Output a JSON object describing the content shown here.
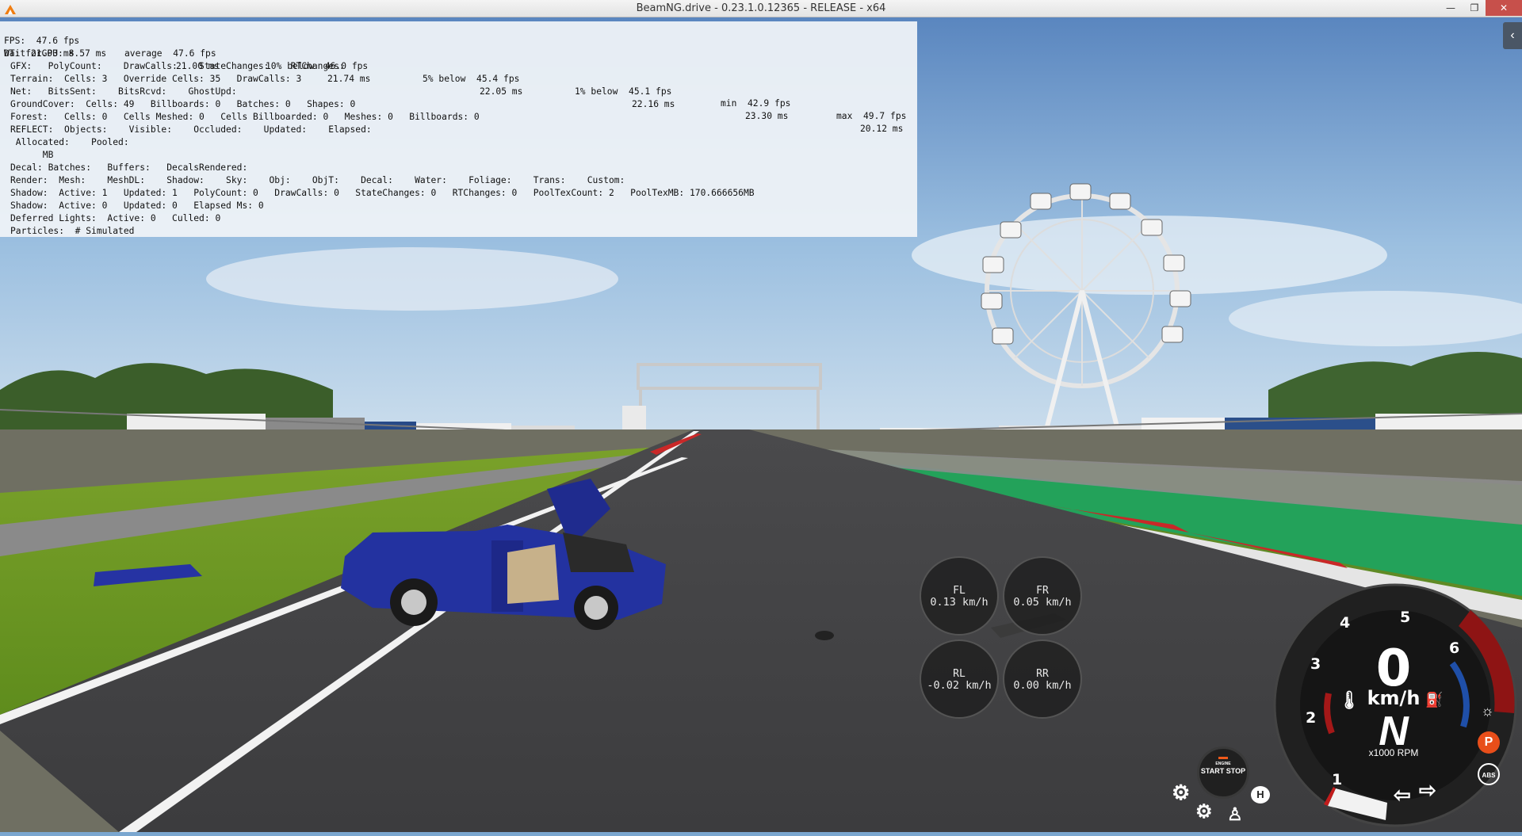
{
  "window": {
    "title": "BeamNG.drive - 0.23.1.0.12365 - RELEASE - x64",
    "minimize_glyph": "—",
    "restore_glyph": "❐",
    "close_glyph": "✕",
    "side_tab_glyph": "‹"
  },
  "debug": {
    "fps_row": [
      "FPS:  47.6 fps",
      "average  47.6 fps",
      "10% below  46.0 fps",
      "5% below  45.4 fps",
      "1% below  45.1 fps",
      "min  42.9 fps",
      "max  49.7 fps"
    ],
    "dt_row": [
      "DT:  21.03 ms",
      "21.00 ms",
      "21.74 ms",
      "22.05 ms",
      "22.16 ms",
      "23.30 ms",
      "20.12 ms"
    ],
    "lines": [
      "WaitforGPU: 8.57 ms",
      "GFX:   PolyCount:    DrawCalls:    StateChanges:    RTChanges:",
      "Terrain:  Cells: 3   Override Cells: 35   DrawCalls: 3",
      "Net:   BitsSent:    BitsRcvd:    GhostUpd:",
      "GroundCover:  Cells: 49   Billboards: 0   Batches: 0   Shapes: 0",
      "Forest:   Cells: 0   Cells Meshed: 0   Cells Billboarded: 0   Meshes: 0   Billboards: 0",
      "REFLECT:  Objects:    Visible:    Occluded:    Updated:    Elapsed:",
      " Allocated:    Pooled:",
      "      MB",
      "Decal: Batches:   Buffers:   DecalsRendered:",
      "Render:  Mesh:    MeshDL:    Shadow:    Sky:    Obj:    ObjT:    Decal:    Water:    Foliage:    Trans:    Custom:",
      "Shadow:  Active: 1   Updated: 1   PolyCount: 0   DrawCalls: 0   StateChanges: 0   RTChanges: 0   PoolTexCount: 2   PoolTexMB: 170.666656MB",
      "Shadow:  Active: 0   Updated: 0   Elapsed Ms: 0",
      "Deferred Lights:  Active: 0   Culled: 0",
      "Particles:  # Simulated"
    ]
  },
  "wheels": [
    {
      "name": "FL",
      "speed": "0.13 km/h"
    },
    {
      "name": "FR",
      "speed": "0.05 km/h"
    },
    {
      "name": "RL",
      "speed": "-0.02 km/h"
    },
    {
      "name": "RR",
      "speed": "0.00 km/h"
    }
  ],
  "dashboard": {
    "speed": "0",
    "speed_unit": "km/h",
    "gear": "N",
    "rpm_label": "x1000 RPM",
    "rpm_ticks": [
      "1",
      "2",
      "3",
      "4",
      "5",
      "6"
    ],
    "rpm_fraction": 0.0,
    "redline_from_thousand_rpm": 5.5,
    "engine_button": {
      "line1": "ENGINE",
      "line2": "START",
      "line3": "STOP"
    },
    "indicators": {
      "parking": "P",
      "abs": "ABS",
      "hill": "H"
    }
  },
  "colors": {
    "accent_red": "#a41818",
    "rpm_blue": "#1f4fa8",
    "parking": "#e84e1a",
    "car_body": "#2332a0"
  }
}
